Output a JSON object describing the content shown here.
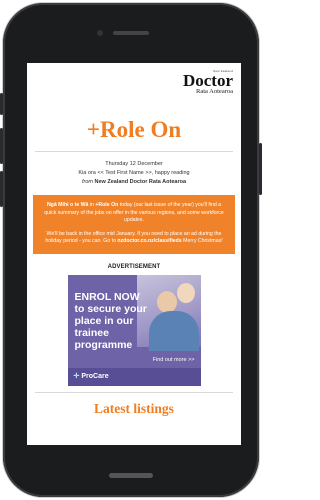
{
  "header": {
    "logo_small": "New Zealand",
    "logo_main": "Doctor",
    "logo_sub": "Rata Aotearoa"
  },
  "newsletter": {
    "title": "+Role On",
    "date": "Thursday 12 December",
    "greeting": "Kia ora << Test First Name >>, happy reading",
    "from_prefix": "from",
    "from_name": "New Zealand Doctor Rata Aotearoa"
  },
  "notice": {
    "para1_bold": "Ngā Mihi o te Wā",
    "para1_mid": " in ",
    "para1_bold2": "+Role On",
    "para1_rest": " today (our last issue of the year) you'll find a quick summary of the jobs on offer in the various regions, and some workforce updates.",
    "para2_text": "We'll be back in the office mid January. If you need to place an ad during the holiday period - you can. Go to ",
    "para2_link": "nzdoctor.co.nz/classifieds",
    "para2_end": " Merry Christmas!"
  },
  "advertisement": {
    "heading": "ADVERTISEMENT",
    "headline": "ENROL NOW to secure your place in our trainee programme",
    "cta": "Find out more >>",
    "brand": "ProCare"
  },
  "listings": {
    "heading": "Latest listings"
  },
  "colors": {
    "accent": "#f07d22",
    "ad_purple": "#6e63a6"
  }
}
